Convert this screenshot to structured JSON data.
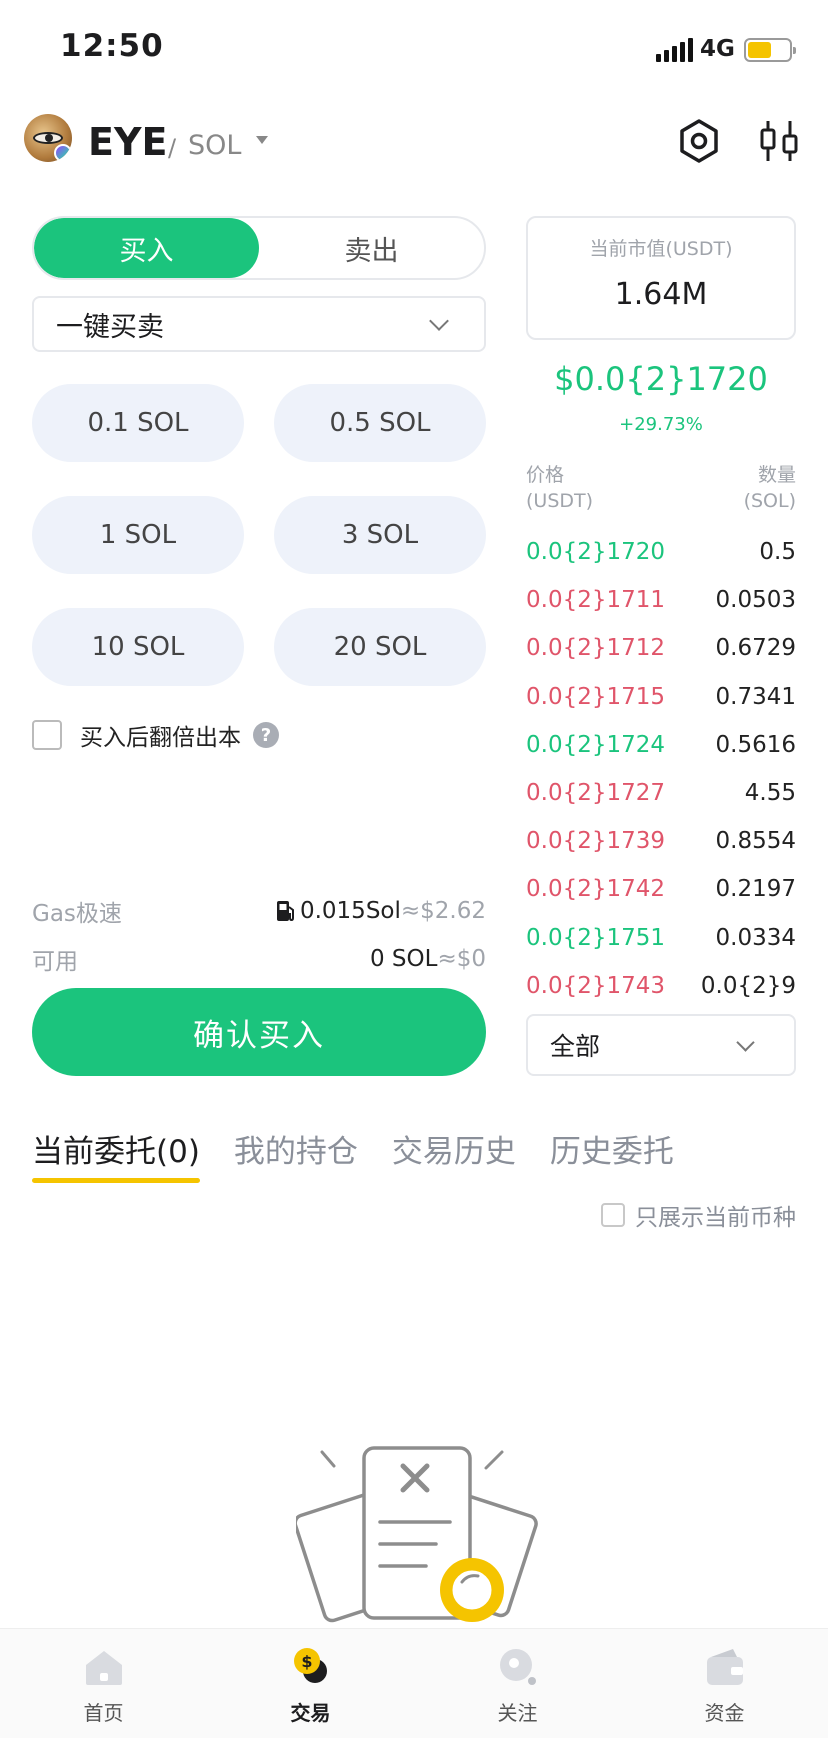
{
  "status_bar": {
    "time": "12:50",
    "network": "4G"
  },
  "header": {
    "base_token": "EYE",
    "separator": "/",
    "quote_token": "SOL",
    "icons": [
      "settings-icon",
      "chart-icon"
    ]
  },
  "trade": {
    "tabs": [
      {
        "label": "买入",
        "active": true
      },
      {
        "label": "卖出",
        "active": false
      }
    ],
    "mode": "一键买卖",
    "amounts": [
      "0.1 SOL",
      "0.5 SOL",
      "1 SOL",
      "3 SOL",
      "10 SOL",
      "20 SOL"
    ],
    "double_label": "买入后翻倍出本",
    "help_symbol": "?",
    "gas_label": "Gas极速",
    "gas_value": "0.015Sol",
    "gas_usd": "≈$2.62",
    "available_label": "可用",
    "available_value": "0 SOL",
    "available_usd": "≈$0",
    "confirm_label": "确认买入"
  },
  "market": {
    "mcap_label": "当前市值(USDT)",
    "mcap_value": "1.64M",
    "price": "$0.0{2}1720",
    "change": "+29.73%",
    "price_header_line1": "价格",
    "price_header_line2": "(USDT)",
    "qty_header_line1": "数量",
    "qty_header_line2": "(SOL)",
    "trades": [
      {
        "price": "0.0{2}1720",
        "qty": "0.5",
        "side": "up"
      },
      {
        "price": "0.0{2}1711",
        "qty": "0.0503",
        "side": "down"
      },
      {
        "price": "0.0{2}1712",
        "qty": "0.6729",
        "side": "down"
      },
      {
        "price": "0.0{2}1715",
        "qty": "0.7341",
        "side": "down"
      },
      {
        "price": "0.0{2}1724",
        "qty": "0.5616",
        "side": "up"
      },
      {
        "price": "0.0{2}1727",
        "qty": "4.55",
        "side": "down"
      },
      {
        "price": "0.0{2}1739",
        "qty": "0.8554",
        "side": "down"
      },
      {
        "price": "0.0{2}1742",
        "qty": "0.2197",
        "side": "down"
      },
      {
        "price": "0.0{2}1751",
        "qty": "0.0334",
        "side": "up"
      },
      {
        "price": "0.0{2}1743",
        "qty": "0.0{2}9",
        "side": "down"
      }
    ],
    "filter": "全部"
  },
  "orders": {
    "tabs": [
      {
        "label": "当前委托(0)",
        "active": true
      },
      {
        "label": "我的持仓",
        "active": false
      },
      {
        "label": "交易历史",
        "active": false
      },
      {
        "label": "历史委托",
        "active": false
      }
    ],
    "show_current_label": "只展示当前币种"
  },
  "bottom_nav": [
    {
      "label": "首页",
      "icon": "home-icon",
      "active": false
    },
    {
      "label": "交易",
      "icon": "trade-icon",
      "active": true
    },
    {
      "label": "关注",
      "icon": "follow-icon",
      "active": false
    },
    {
      "label": "资金",
      "icon": "wallet-icon",
      "active": false
    }
  ],
  "colors": {
    "accent_green": "#1bc47d",
    "down_red": "#e0556a",
    "highlight_yellow": "#f5c400"
  }
}
